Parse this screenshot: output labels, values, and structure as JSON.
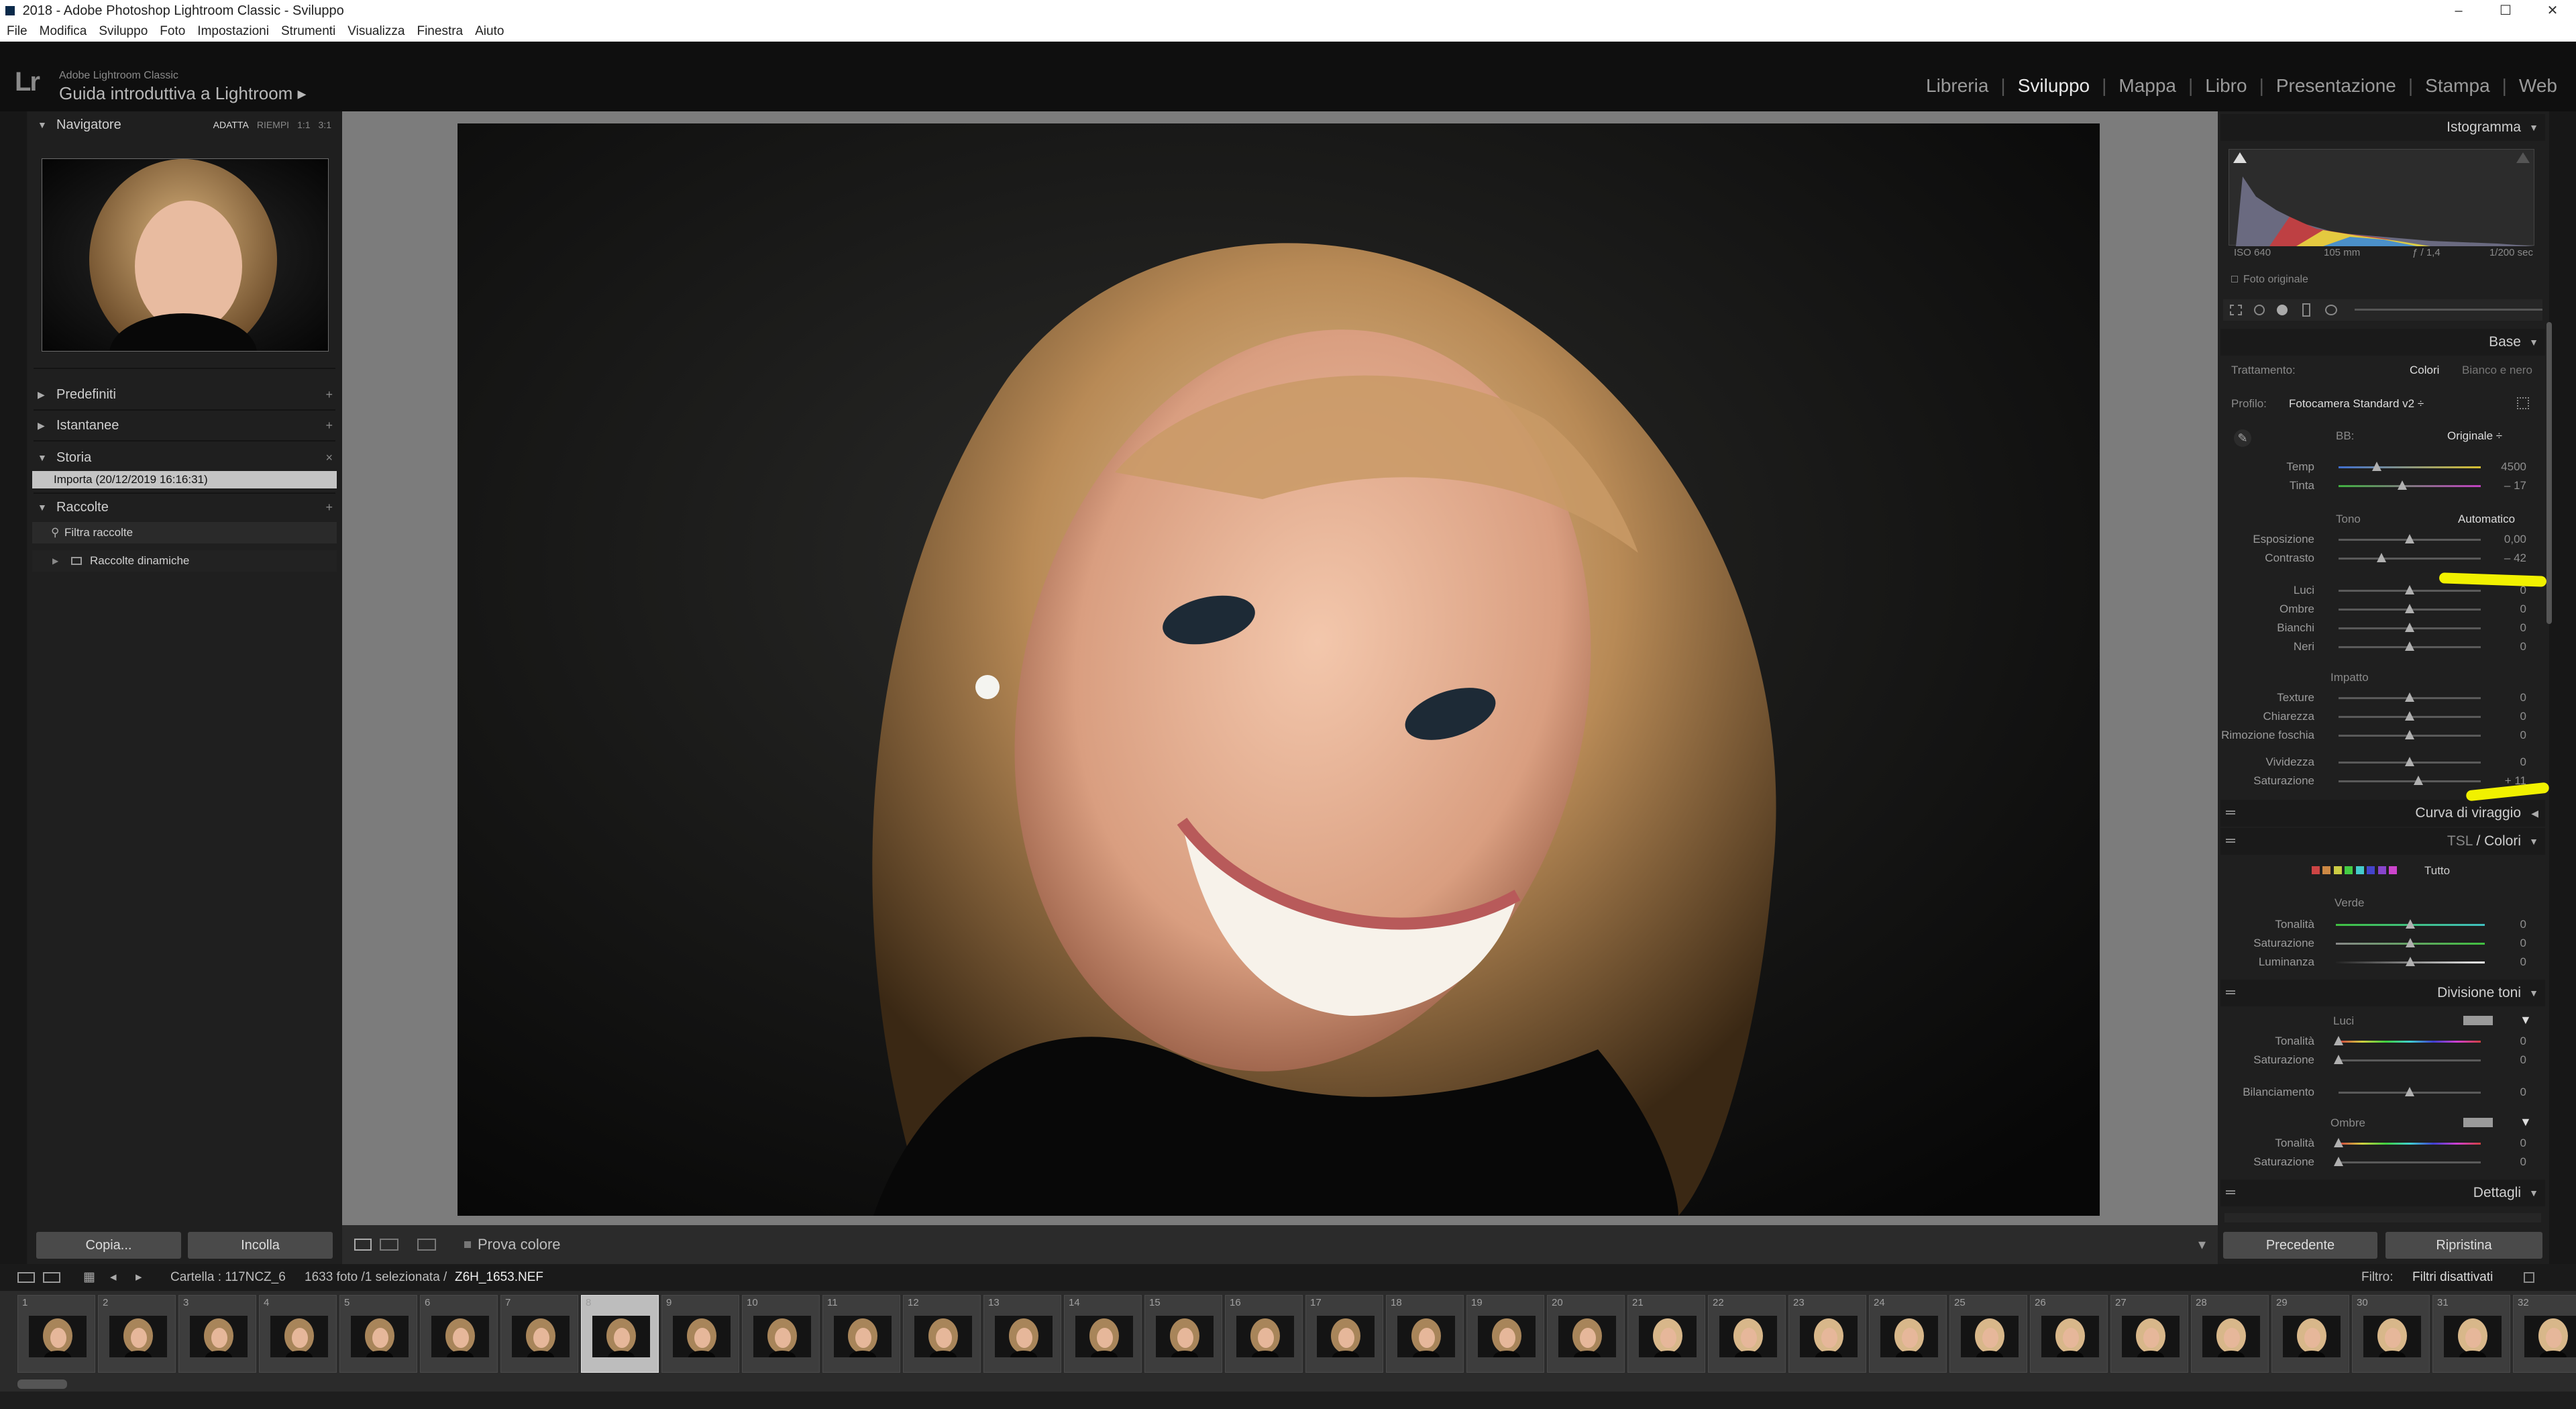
{
  "window": {
    "title": "2018 - Adobe Photoshop Lightroom Classic - Sviluppo",
    "controls": [
      "–",
      "☐",
      "✕"
    ]
  },
  "menu": [
    "File",
    "Modifica",
    "Sviluppo",
    "Foto",
    "Impostazioni",
    "Strumenti",
    "Visualizza",
    "Finestra",
    "Aiuto"
  ],
  "identity": {
    "logo": "Lr",
    "app_name": "Adobe Lightroom Classic",
    "guide": "Guida introduttiva a Lightroom ▸"
  },
  "modules": {
    "items": [
      "Libreria",
      "Sviluppo",
      "Mappa",
      "Libro",
      "Presentazione",
      "Stampa",
      "Web"
    ],
    "active": "Sviluppo"
  },
  "left": {
    "navigator": {
      "title": "Navigatore",
      "zoom": [
        "ADATTA",
        "RIEMPI",
        "1:1",
        "3:1"
      ]
    },
    "presets": "Predefiniti",
    "snapshots": "Istantanee",
    "history": {
      "title": "Storia",
      "item": "Importa (20/12/2019 16:16:31)"
    },
    "collections": {
      "title": "Raccolte",
      "filter": "Filtra raccolte",
      "smart": "Raccolte dinamiche"
    },
    "copy_btn": "Copia...",
    "paste_btn": "Incolla"
  },
  "toolbar": {
    "softproof": "Prova colore"
  },
  "right": {
    "histogram": {
      "title": "Istogramma",
      "iso": "ISO 640",
      "focal": "105 mm",
      "aperture": "ƒ / 1,4",
      "shutter": "1/200 sec",
      "original": "Foto originale"
    },
    "basic": {
      "title": "Base",
      "treatment_label": "Trattamento:",
      "treatment_color": "Colori",
      "treatment_bw": "Bianco e nero",
      "profile_label": "Profilo:",
      "profile_value": "Fotocamera Standard v2 ÷",
      "wb_label": "BB:",
      "wb_value": "Originale ÷",
      "tone_label": "Tono",
      "auto": "Automatico",
      "presence_label": "Impatto"
    },
    "sliders": [
      {
        "label": "Temp",
        "value": "4500",
        "pos": 0.27
      },
      {
        "label": "Tinta",
        "value": "– 17",
        "pos": 0.45
      },
      {
        "label": "Esposizione",
        "value": "0,00",
        "pos": 0.5
      },
      {
        "label": "Contrasto",
        "value": "– 42",
        "pos": 0.3
      },
      {
        "label": "Luci",
        "value": "0",
        "pos": 0.5
      },
      {
        "label": "Ombre",
        "value": "0",
        "pos": 0.5
      },
      {
        "label": "Bianchi",
        "value": "0",
        "pos": 0.5
      },
      {
        "label": "Neri",
        "value": "0",
        "pos": 0.5
      },
      {
        "label": "Texture",
        "value": "0",
        "pos": 0.5
      },
      {
        "label": "Chiarezza",
        "value": "0",
        "pos": 0.5
      },
      {
        "label": "Rimozione foschia",
        "value": "0",
        "pos": 0.5
      },
      {
        "label": "Vividezza",
        "value": "0",
        "pos": 0.5
      },
      {
        "label": "Saturazione",
        "value": "+ 11",
        "pos": 0.56
      }
    ],
    "tone_curve": "Curva di viraggio",
    "hsl": {
      "title_a": "TSL",
      "title_b": "Colori",
      "all": "Tutto",
      "group": "Verde",
      "rows": [
        {
          "label": "Tonalità",
          "value": "0"
        },
        {
          "label": "Saturazione",
          "value": "0"
        },
        {
          "label": "Luminanza",
          "value": "0"
        }
      ]
    },
    "split": {
      "title": "Divisione toni",
      "highlights": "Luci",
      "balance": "Bilanciamento",
      "shadows": "Ombre",
      "rows": [
        {
          "label": "Tonalità",
          "value": "0"
        },
        {
          "label": "Saturazione",
          "value": "0"
        },
        {
          "label": "Bilanciamento",
          "value": "0"
        },
        {
          "label": "Tonalità",
          "value": "0"
        },
        {
          "label": "Saturazione",
          "value": "0"
        }
      ]
    },
    "details": "Dettagli",
    "prev_btn": "Precedente",
    "reset_btn": "Ripristina"
  },
  "filmstrip": {
    "folder": "Cartella : 117NCZ_6",
    "count": "1633 foto /1 selezionata /",
    "filename": "Z6H_1653.NEF",
    "filter_label": "Filtro:",
    "filter_value": "Filtri disattivati",
    "frames": [
      "1",
      "2",
      "3",
      "4",
      "5",
      "6",
      "7",
      "8",
      "9",
      "10",
      "11",
      "12",
      "13",
      "14",
      "15",
      "16",
      "17",
      "18",
      "19",
      "20",
      "21",
      "22",
      "23",
      "24",
      "25",
      "26",
      "27",
      "28",
      "29",
      "30",
      "31",
      "32"
    ],
    "selected": "8"
  }
}
